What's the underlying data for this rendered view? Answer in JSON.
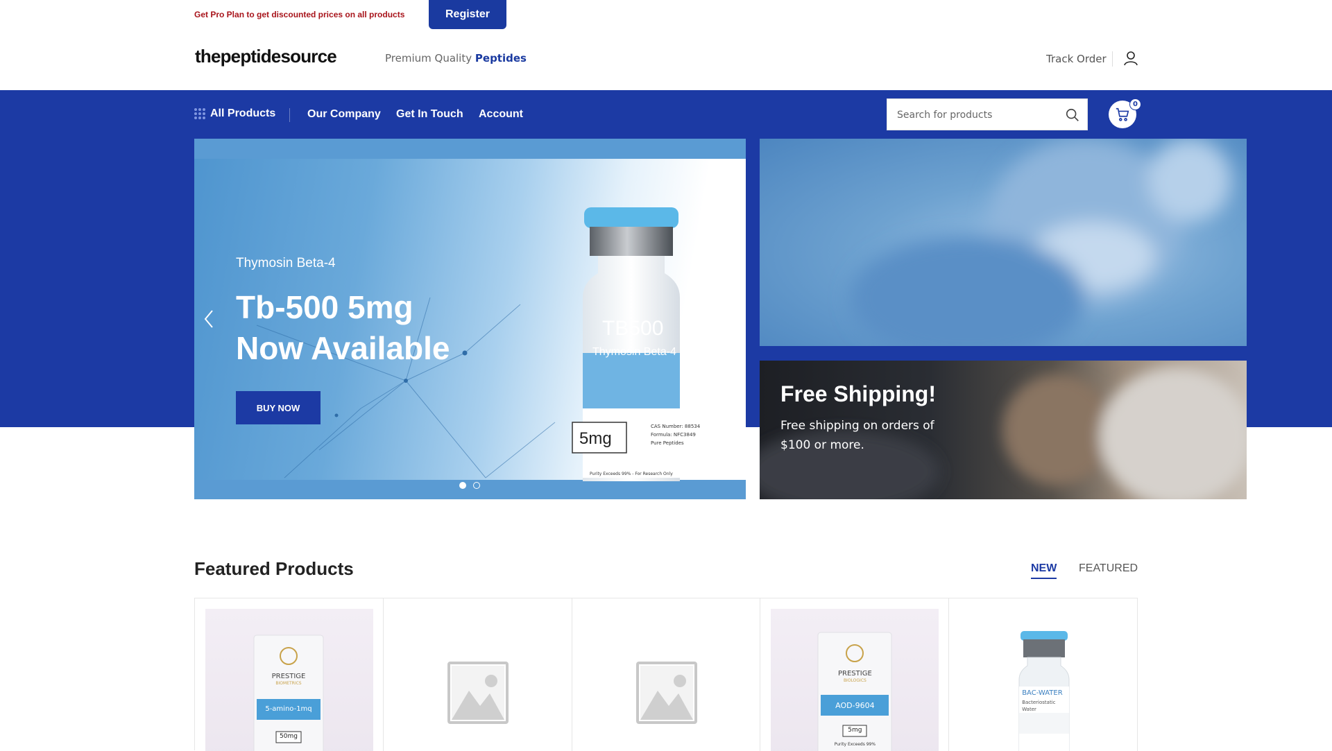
{
  "promo": {
    "text": "Get Pro Plan to get discounted prices on all products",
    "register_label": "Register"
  },
  "header": {
    "logo": "thepeptidesource",
    "tagline_prefix": "Premium Quality",
    "tagline_highlight": "Peptides",
    "track_order": "Track Order"
  },
  "nav": {
    "all_products": "All Products",
    "links": [
      "Our Company",
      "Get In Touch",
      "Account"
    ],
    "search_placeholder": "Search for products",
    "cart_count": "0"
  },
  "hero": {
    "subtitle": "Thymosin Beta-4",
    "title_line1": "Tb-500 5mg",
    "title_line2": "Now Available",
    "button": "BUY NOW",
    "vial": {
      "name": "TB500",
      "subname": "Thymosin Beta-4",
      "dose": "5mg",
      "cas": "CAS Number: 88534",
      "formula": "Formula: NFC3849",
      "brand_note": "Pure Peptides",
      "footer": "Purity Exceeds 99% - For Research Only"
    },
    "slides_total": 2,
    "active_slide": 1
  },
  "shipping_banner": {
    "title": "Free Shipping!",
    "text": "Free shipping on orders of $100 or more."
  },
  "featured": {
    "title": "Featured Products",
    "tabs": [
      "NEW",
      "FEATURED"
    ],
    "active_tab": "NEW",
    "products": [
      {
        "brand": "PRESTIGE",
        "brand_sub": "BIOMETRICS",
        "label": "5-amino-1mq",
        "dose": "50mg",
        "type": "box"
      },
      {
        "type": "placeholder"
      },
      {
        "type": "placeholder"
      },
      {
        "brand": "PRESTIGE",
        "brand_sub": "BIOLOGICS",
        "label": "AOD-9604",
        "dose": "5mg",
        "footer": "Purity Exceeds 99%",
        "type": "box"
      },
      {
        "label": "BAC-WATER",
        "sub": "Bacteriostatic Water",
        "type": "vial"
      }
    ]
  },
  "colors": {
    "brand_blue": "#1c3aa4",
    "promo_red": "#a8141b",
    "vial_cap": "#5bb8e8"
  }
}
